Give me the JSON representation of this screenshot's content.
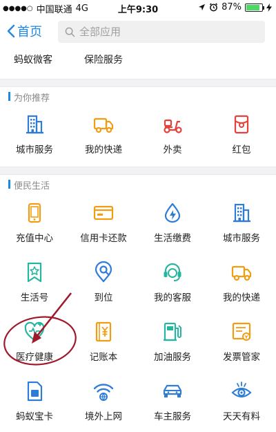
{
  "status_bar": {
    "signal": "●●●●○",
    "carrier": "中国联通",
    "network": "4G",
    "time": "上午9:30",
    "battery_percent": "87%",
    "battery_level": 0.87
  },
  "nav": {
    "back_label": "首页",
    "search_placeholder": "全部应用"
  },
  "partial_row": {
    "items": [
      {
        "label": "蚂蚁微客"
      },
      {
        "label": "保险服务"
      }
    ]
  },
  "section_recommend": {
    "title": "为你推荐",
    "items": [
      {
        "label": "城市服务",
        "icon": "city-building-icon",
        "color": "#2f7cd6"
      },
      {
        "label": "我的快递",
        "icon": "delivery-truck-icon",
        "color": "#f39c12"
      },
      {
        "label": "外卖",
        "icon": "scooter-icon",
        "color": "#e5403a"
      },
      {
        "label": "红包",
        "icon": "red-envelope-icon",
        "color": "#e5403a"
      }
    ]
  },
  "section_life": {
    "title": "便民生活",
    "items": [
      {
        "label": "充值中心",
        "icon": "phone-icon",
        "color": "#f39c12"
      },
      {
        "label": "信用卡还款",
        "icon": "credit-card-icon",
        "color": "#f39c12"
      },
      {
        "label": "生活缴费",
        "icon": "drop-bolt-icon",
        "color": "#2f7cd6"
      },
      {
        "label": "城市服务",
        "icon": "city-building-icon",
        "color": "#2f7cd6"
      },
      {
        "label": "生活号",
        "icon": "star-bookmark-icon",
        "color": "#26b5a0"
      },
      {
        "label": "到位",
        "icon": "location-pin-icon",
        "color": "#2f7cd6"
      },
      {
        "label": "我的客服",
        "icon": "headset-icon",
        "color": "#26b5a0"
      },
      {
        "label": "我的快递",
        "icon": "delivery-truck-icon",
        "color": "#f39c12"
      },
      {
        "label": "医疗健康",
        "icon": "medical-heart-icon",
        "color": "#26b5a0"
      },
      {
        "label": "记账本",
        "icon": "yuan-book-icon",
        "color": "#f39c12"
      },
      {
        "label": "加油服务",
        "icon": "fuel-pump-icon",
        "color": "#26b5a0"
      },
      {
        "label": "发票管家",
        "icon": "invoice-icon",
        "color": "#f39c12"
      },
      {
        "label": "蚂蚁宝卡",
        "icon": "sim-card-icon",
        "color": "#2f7cd6"
      },
      {
        "label": "境外上网",
        "icon": "wifi-globe-icon",
        "color": "#2f7cd6"
      },
      {
        "label": "车主服务",
        "icon": "car-icon",
        "color": "#2f7cd6"
      },
      {
        "label": "天天有料",
        "icon": "eye-broadcast-icon",
        "color": "#2f7cd6"
      }
    ]
  },
  "annotation": {
    "arrow_color": "#a0192a",
    "circle_color": "#a0192a"
  },
  "accent_color": "#1e88e5"
}
